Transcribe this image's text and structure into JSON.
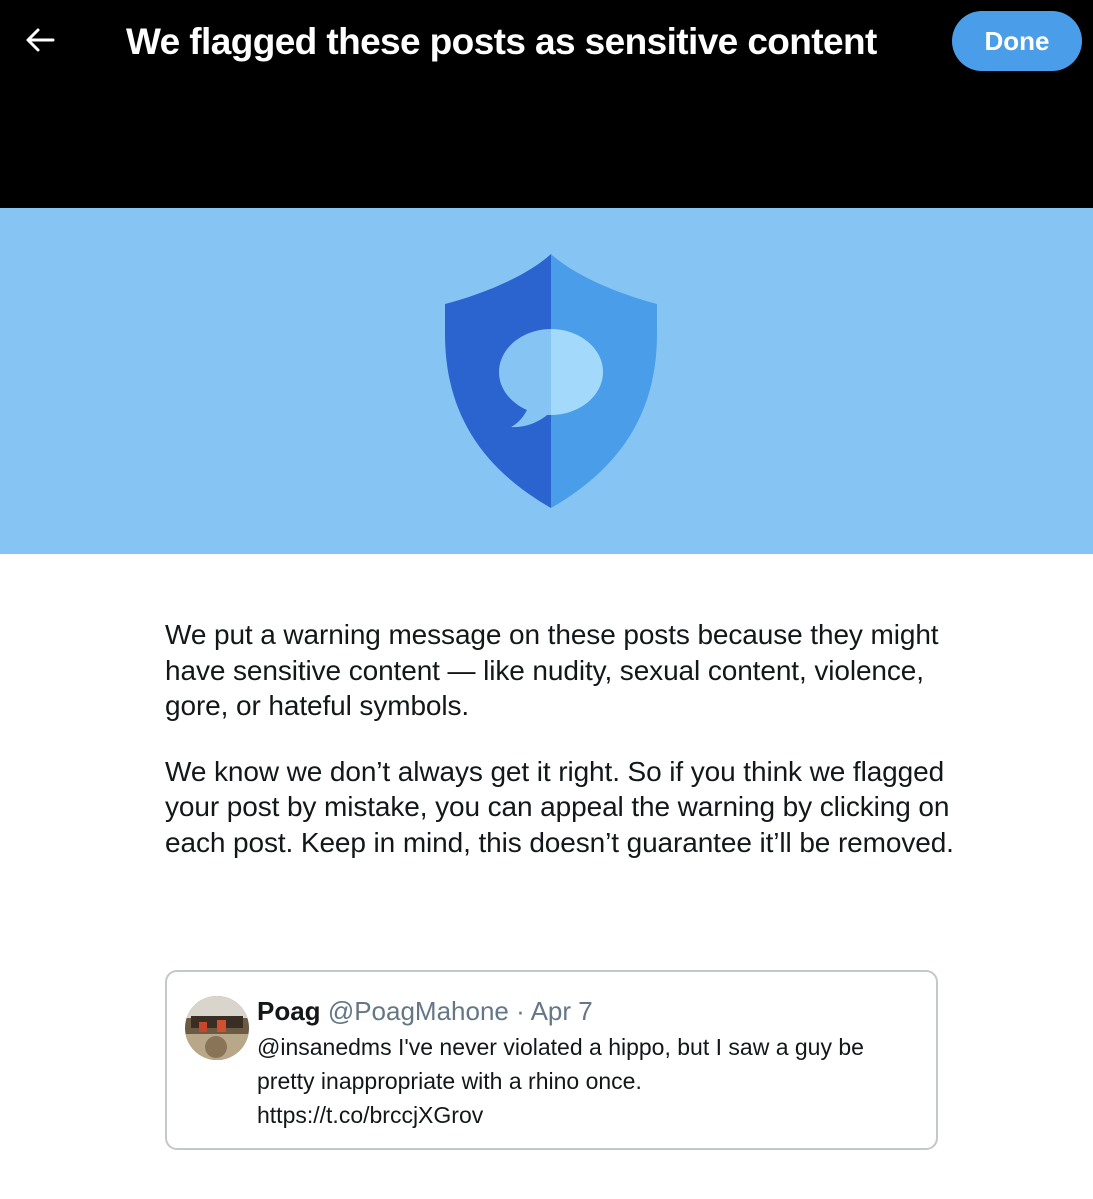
{
  "header": {
    "back_icon": "arrow-left-icon",
    "title": "We flagged these posts as sensitive content",
    "done_label": "Done"
  },
  "banner": {
    "icon": "shield-chat-icon",
    "colors": {
      "background": "#86c5f3",
      "shield_left": "#2b63cf",
      "shield_right": "#4a9de8",
      "bubble_left": "#86c5f3",
      "bubble_right": "#a3d9fa"
    }
  },
  "body": {
    "paragraph_1": "We put a warning message on these posts because they might have sensitive content — like nudity, sexual content, violence, gore, or hateful symbols.",
    "paragraph_2": "We know we don’t always get it right. So if you think we flagged your post by mistake, you can appeal the warning by clicking on each post. Keep in mind, this doesn’t guarantee it’ll be removed."
  },
  "tweet": {
    "name": "Poag",
    "handle": "@PoagMahone",
    "separator": "·",
    "date": "Apr 7",
    "text_lines": [
      "@insanedms I've never violated a hippo, but I saw a guy be",
      "pretty inappropriate with a rhino once.",
      "https://t.co/brccjXGrov"
    ]
  },
  "colors": {
    "header_bg": "#000000",
    "accent": "#4a9de8",
    "text": "#14171a",
    "muted": "#657786",
    "card_border": "#c4c8cc"
  }
}
